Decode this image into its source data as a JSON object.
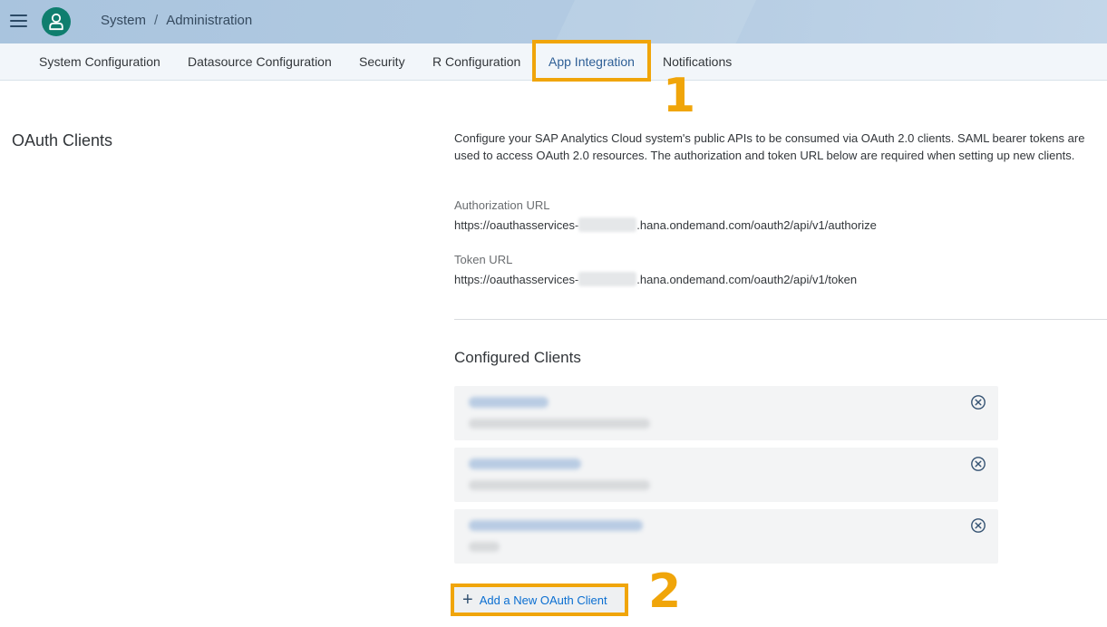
{
  "shell": {
    "menu_icon": "hamburger-menu-icon",
    "avatar_icon": "user-icon",
    "breadcrumb": {
      "parent": "System",
      "separator": "/",
      "current": "Administration"
    }
  },
  "tabs": [
    {
      "label": "System Configuration"
    },
    {
      "label": "Datasource Configuration"
    },
    {
      "label": "Security"
    },
    {
      "label": "R Configuration"
    },
    {
      "label": "App Integration",
      "active": true
    },
    {
      "label": "Notifications"
    }
  ],
  "annotations": {
    "step1": "1",
    "step2": "2"
  },
  "section": {
    "title": "OAuth Clients",
    "description": "Configure your SAP Analytics Cloud system's public APIs to be consumed via OAuth 2.0 clients. SAML bearer tokens are used to access OAuth 2.0 resources. The authorization and token URL below are required when setting up new clients.",
    "auth_url_label": "Authorization URL",
    "auth_url_prefix": "https://oauthasservices-",
    "auth_url_suffix": ".hana.ondemand.com/oauth2/api/v1/authorize",
    "token_url_label": "Token URL",
    "token_url_prefix": "https://oauthasservices-",
    "token_url_suffix": ".hana.ondemand.com/oauth2/api/v1/token"
  },
  "configured": {
    "title": "Configured Clients",
    "clients": [
      {
        "remove_icon": "remove-circle-icon"
      },
      {
        "remove_icon": "remove-circle-icon"
      },
      {
        "remove_icon": "remove-circle-icon"
      }
    ],
    "add_button_icon": "add-icon",
    "add_button_label": "Add a New OAuth Client"
  },
  "colors": {
    "shell_bg": "#b3cbe2",
    "tab_bar_bg": "#f2f6fa",
    "active_tab": "#2e5f96",
    "highlight": "#f0a50a",
    "avatar_bg": "#0f7e6e",
    "link": "#0a6ed1"
  }
}
